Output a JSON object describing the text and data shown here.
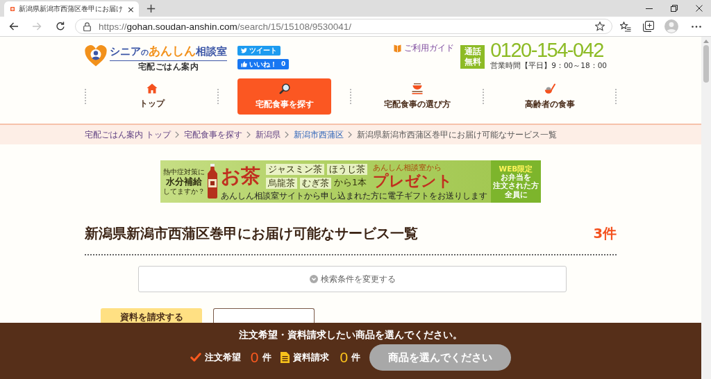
{
  "browser": {
    "tab": {
      "title": "新潟県新潟市西蒲区巻甲にお届け",
      "close": "×",
      "selected": true
    },
    "new_tab": "+",
    "forward_disabled": true,
    "url": {
      "scheme": "https://",
      "host": "gohan.soudan-anshin.com",
      "path": "/search/15/15108/9530041/"
    }
  },
  "header": {
    "logo": {
      "title": [
        {
          "text": "シニア",
          "color": "#3c56a6"
        },
        {
          "text": "の",
          "color": "#3c56a6"
        },
        {
          "text": "あんしん",
          "color": "#f2911b"
        },
        {
          "text": "相談室",
          "color": "#3c56a6"
        }
      ],
      "subtitle": "宅配ごはん案内"
    },
    "social": {
      "tweet": "ツイート",
      "like": "いいね！",
      "like_count": "0"
    },
    "guide": "ご利用ガイド",
    "phone": {
      "badge": [
        "通話",
        "無料"
      ],
      "number": "0120-154-042",
      "hours": "営業時間【平日】9：00～18：00"
    }
  },
  "nav": [
    {
      "label": "トップ",
      "selected": false
    },
    {
      "label": "宅配食事を探す",
      "selected": true
    },
    {
      "label": "宅配食事の選び方",
      "selected": false
    },
    {
      "label": "高齢者の食事",
      "selected": false
    }
  ],
  "breadcrumb": [
    {
      "label": "宅配ごはん案内 トップ",
      "kind": "link",
      "visited": true
    },
    {
      "label": "宅配食事を探す",
      "kind": "link",
      "visited": true
    },
    {
      "label": "新潟県",
      "kind": "link",
      "visited": true
    },
    {
      "label": "新潟市西蒲区",
      "kind": "link",
      "visited": false
    },
    {
      "label": "新潟県新潟市西蒲区巻甲にお届け可能なサービス一覧",
      "kind": "current"
    }
  ],
  "banner": {
    "question": [
      "熱中症対策に",
      "水分補給",
      "してますか？"
    ],
    "headline": "お茶",
    "teas": [
      "ジャスミン茶",
      "ほうじ茶",
      "烏龍茶",
      "むぎ茶"
    ],
    "amount": "から1本",
    "sender": "あんしん相談室から",
    "present": "プレゼント",
    "note": "あんしん相談室サイトから申し込まれた方に電子ギフトをお送りします",
    "offer": [
      "WEB限定",
      "お弁当を",
      "注文された方",
      "全員に"
    ]
  },
  "results": {
    "title": "新潟県新潟市西蒲区巻甲にお届け可能なサービス一覧",
    "count": "3件",
    "search_toggle": "検索条件を変更する"
  },
  "actions": {
    "request_button": "資料を請求する"
  },
  "order_bar": {
    "message": "注文希望・資料請求したい商品を選んでください。",
    "order_label": "注文希望",
    "order_count": "0",
    "order_unit": "件",
    "request_label": "資料請求",
    "request_count": "0",
    "request_unit": "件",
    "submit": "商品を選んでください",
    "submit_disabled": true
  }
}
